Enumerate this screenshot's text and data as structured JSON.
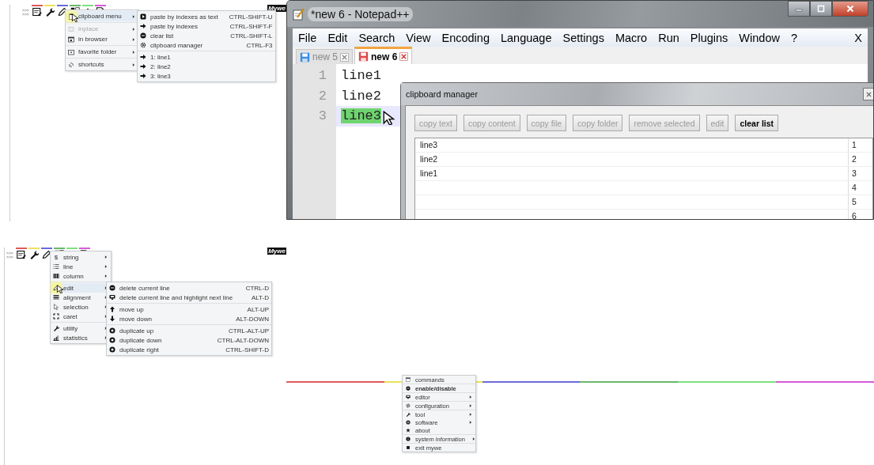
{
  "clipboard_demo": {
    "prompt": [
      ">>>",
      ">>>"
    ],
    "stripes": [
      {
        "color": "#e05a5a"
      },
      {
        "color": "#ece25a"
      },
      {
        "color": "#6a6ad8"
      },
      {
        "color": "#6ab86a"
      },
      {
        "color": "#7ee07e"
      },
      {
        "color": "#d85ad8"
      }
    ],
    "badge": "Mywe",
    "menu": [
      {
        "items": [
          {
            "label": "clipboard menu",
            "submenu": true,
            "selected": true,
            "disabled": false
          }
        ]
      },
      {
        "items": [
          {
            "label": "inplace",
            "submenu": true,
            "selected": false,
            "disabled": true
          },
          {
            "label": "in browser",
            "submenu": true,
            "selected": false,
            "disabled": false
          }
        ]
      },
      {
        "items": [
          {
            "label": "favorite folder",
            "submenu": true,
            "selected": false,
            "disabled": false
          }
        ]
      },
      {
        "items": [
          {
            "label": "shortcuts",
            "submenu": true,
            "selected": false,
            "disabled": false
          }
        ]
      }
    ],
    "submenu": [
      {
        "items": [
          {
            "label": "paste by indexes as text",
            "shortcut": "CTRL-SHIFT-U"
          },
          {
            "label": "paste by indexes",
            "shortcut": "CTRL-SHIFT-F"
          },
          {
            "label": "clear list",
            "shortcut": "CTRL-SHIFT-L"
          },
          {
            "label": "clipboard manager",
            "shortcut": "CTRL-F3"
          }
        ]
      },
      {
        "items": [
          {
            "label": "1: line1"
          },
          {
            "label": "2: line2"
          },
          {
            "label": "3: line3"
          }
        ]
      }
    ]
  },
  "notepad": {
    "title": "*new  6 - Notepad++",
    "menu": [
      "File",
      "Edit",
      "Search",
      "View",
      "Encoding",
      "Language",
      "Settings",
      "Macro",
      "Run",
      "Plugins",
      "Window",
      "?"
    ],
    "close_doc": "X",
    "tabs": [
      {
        "label": "new  5",
        "selected": false
      },
      {
        "label": "new  6",
        "selected": true
      }
    ],
    "lines": [
      {
        "number": "1",
        "text": "line1",
        "selected": false
      },
      {
        "number": "2",
        "text": "line2",
        "selected": false
      },
      {
        "number": "3",
        "text": "line3",
        "selected": true
      }
    ],
    "dialog": {
      "title": "clipboard manager",
      "buttons": [
        {
          "label": "copy text",
          "disabled": true
        },
        {
          "label": "copy content",
          "disabled": true
        },
        {
          "label": "copy file",
          "disabled": true
        },
        {
          "label": "copy folder",
          "disabled": true
        },
        {
          "label": "remove selected",
          "disabled": true
        },
        {
          "label": "edit",
          "disabled": true
        },
        {
          "label": "clear list",
          "disabled": false
        }
      ],
      "rows": [
        {
          "text": "line3",
          "index": "1"
        },
        {
          "text": "line2",
          "index": "2"
        },
        {
          "text": "line1",
          "index": "3"
        },
        {
          "index": "4"
        },
        {
          "index": "5"
        },
        {
          "index": "6"
        }
      ]
    }
  },
  "edit_demo": {
    "prompt": [
      ">>>",
      ">>>"
    ],
    "stripes": [
      {
        "color": "#e05a5a"
      },
      {
        "color": "#ece25a"
      },
      {
        "color": "#6a6ad8"
      },
      {
        "color": "#6ab86a"
      },
      {
        "color": "#7ee07e"
      },
      {
        "color": "#d85ad8"
      }
    ],
    "badge": "Mywe",
    "menu": [
      {
        "items": [
          {
            "label": "string",
            "glyph": "$",
            "submenu": true,
            "selected": false
          },
          {
            "label": "line",
            "submenu": true,
            "selected": false
          },
          {
            "label": "column",
            "submenu": true,
            "selected": false
          }
        ]
      },
      {
        "items": [
          {
            "label": "edit",
            "submenu": true,
            "selected": true
          },
          {
            "label": "alignment",
            "submenu": true,
            "selected": false
          },
          {
            "label": "selection",
            "submenu": true,
            "selected": false
          },
          {
            "label": "caret",
            "submenu": true,
            "selected": false
          }
        ]
      },
      {
        "items": [
          {
            "label": "utility",
            "submenu": true,
            "selected": false
          },
          {
            "label": "statistics",
            "submenu": true,
            "selected": false
          }
        ]
      }
    ],
    "submenu": [
      {
        "items": [
          {
            "label": "delete current line",
            "shortcut": "CTRL-D"
          },
          {
            "label": "delete current line and highlight next line",
            "shortcut": "ALT-D"
          }
        ]
      },
      {
        "items": [
          {
            "label": "move up",
            "shortcut": "ALT-UP"
          },
          {
            "label": "move down",
            "shortcut": "ALT-DOWN"
          }
        ]
      },
      {
        "items": [
          {
            "label": "duplicate up",
            "shortcut": "CTRL-ALT-UP"
          },
          {
            "label": "duplicate down",
            "shortcut": "CTRL-ALT-DOWN"
          },
          {
            "label": "duplicate right",
            "shortcut": "CTRL-SHIFT-D"
          }
        ]
      }
    ]
  },
  "tray_menu": {
    "bar": [
      {
        "color": "#e05a5a"
      },
      {
        "color": "#ece25a"
      },
      {
        "color": "#6a6ad8"
      },
      {
        "color": "#6ab86a"
      },
      {
        "color": "#7ee07e"
      },
      {
        "color": "#d85ad8"
      }
    ],
    "menu": [
      {
        "items": [
          {
            "label": "commands",
            "submenu": false,
            "default": false
          }
        ]
      },
      {
        "items": [
          {
            "label": "enable/disable",
            "submenu": false,
            "default": true
          }
        ]
      },
      {
        "items": [
          {
            "label": "editor",
            "submenu": true,
            "default": false
          }
        ]
      },
      {
        "items": [
          {
            "label": "configuration",
            "submenu": true,
            "default": false
          }
        ]
      },
      {
        "items": [
          {
            "label": "tool",
            "submenu": true,
            "default": false
          },
          {
            "label": "software",
            "submenu": true,
            "default": false
          },
          {
            "label": "about",
            "submenu": false,
            "default": false
          }
        ]
      },
      {
        "items": [
          {
            "label": "system information",
            "submenu": true,
            "default": false
          }
        ]
      },
      {
        "items": [
          {
            "label": "exit mywe",
            "submenu": false,
            "default": false
          }
        ]
      }
    ]
  }
}
